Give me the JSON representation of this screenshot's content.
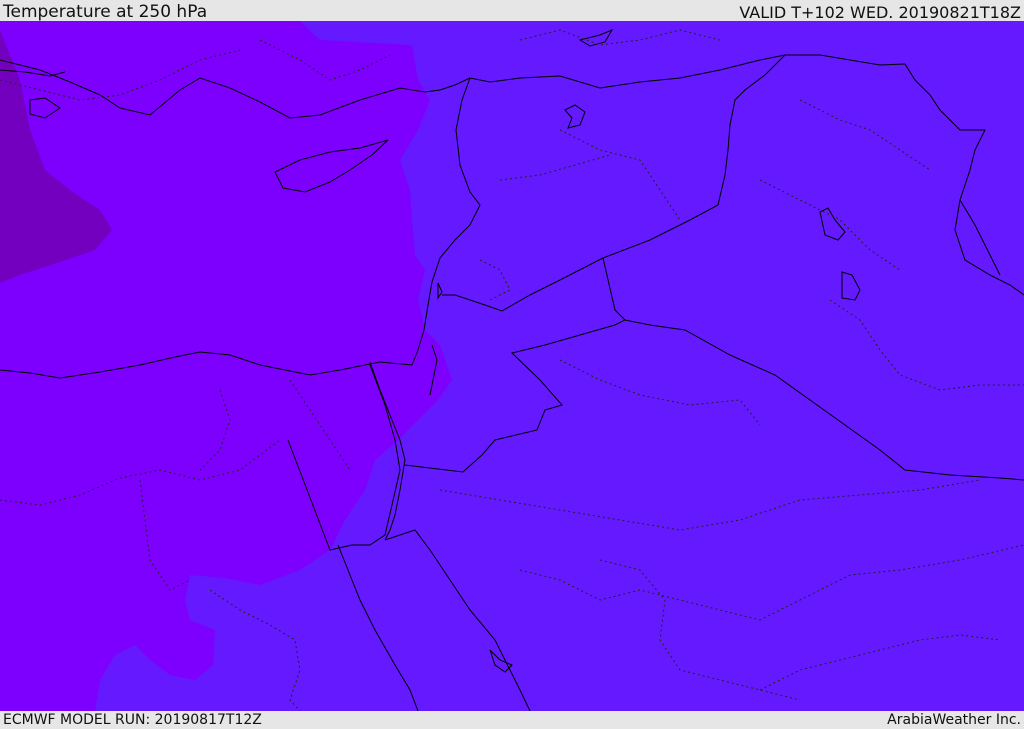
{
  "header": {
    "title": "Temperature at 250 hPa",
    "valid": "VALID T+102 WED. 20190821T18Z"
  },
  "footer": {
    "model_run": "ECMWF MODEL RUN: 20190817T12Z",
    "credit": "ArabiaWeather Inc."
  },
  "map": {
    "field": "temperature",
    "level": "250 hPa",
    "colors": {
      "cold_core": "#7300bf",
      "purple": "#7d00ff",
      "violet": "#6419ff",
      "coast": "#000000",
      "border": "#000000"
    }
  }
}
